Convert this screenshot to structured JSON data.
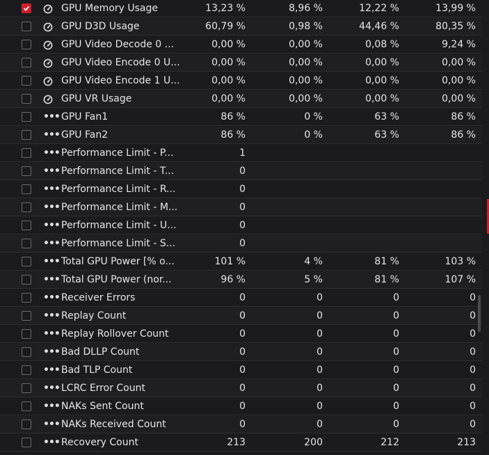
{
  "icons": {
    "gauge": "gauge-icon",
    "more": "more-icon",
    "check": "checkmark-icon"
  },
  "colors": {
    "accent": "#d01f2a",
    "background": "#1b1b1d",
    "row_alt": "#1f1f21",
    "divider": "#2e2e31"
  },
  "rows": [
    {
      "name": "GPU Memory Usage",
      "icon": "gauge",
      "checked": true,
      "v1": "13,23 %",
      "v2": "8,96 %",
      "v3": "12,22 %",
      "v4": "13,99 %"
    },
    {
      "name": "GPU D3D Usage",
      "icon": "gauge",
      "checked": false,
      "v1": "60,79 %",
      "v2": "0,98 %",
      "v3": "44,46 %",
      "v4": "80,35 %"
    },
    {
      "name": "GPU Video Decode 0 ...",
      "icon": "gauge",
      "checked": false,
      "v1": "0,00 %",
      "v2": "0,00 %",
      "v3": "0,08 %",
      "v4": "9,24 %"
    },
    {
      "name": "GPU Video Encode 0 U...",
      "icon": "gauge",
      "checked": false,
      "v1": "0,00 %",
      "v2": "0,00 %",
      "v3": "0,00 %",
      "v4": "0,00 %"
    },
    {
      "name": "GPU Video Encode 1 U...",
      "icon": "gauge",
      "checked": false,
      "v1": "0,00 %",
      "v2": "0,00 %",
      "v3": "0,00 %",
      "v4": "0,00 %"
    },
    {
      "name": "GPU VR Usage",
      "icon": "gauge",
      "checked": false,
      "v1": "0,00 %",
      "v2": "0,00 %",
      "v3": "0,00 %",
      "v4": "0,00 %"
    },
    {
      "name": "GPU Fan1",
      "icon": "more",
      "checked": false,
      "v1": "86 %",
      "v2": "0 %",
      "v3": "63 %",
      "v4": "86 %"
    },
    {
      "name": "GPU Fan2",
      "icon": "more",
      "checked": false,
      "v1": "86 %",
      "v2": "0 %",
      "v3": "63 %",
      "v4": "86 %"
    },
    {
      "name": "Performance Limit - P...",
      "icon": "more",
      "checked": false,
      "v1": "1",
      "v2": "",
      "v3": "",
      "v4": ""
    },
    {
      "name": "Performance Limit - T...",
      "icon": "more",
      "checked": false,
      "v1": "0",
      "v2": "",
      "v3": "",
      "v4": ""
    },
    {
      "name": "Performance Limit - R...",
      "icon": "more",
      "checked": false,
      "v1": "0",
      "v2": "",
      "v3": "",
      "v4": ""
    },
    {
      "name": "Performance Limit - M...",
      "icon": "more",
      "checked": false,
      "v1": "0",
      "v2": "",
      "v3": "",
      "v4": ""
    },
    {
      "name": "Performance Limit - U...",
      "icon": "more",
      "checked": false,
      "v1": "0",
      "v2": "",
      "v3": "",
      "v4": ""
    },
    {
      "name": "Performance Limit - S...",
      "icon": "more",
      "checked": false,
      "v1": "0",
      "v2": "",
      "v3": "",
      "v4": ""
    },
    {
      "name": "Total GPU Power [% o...",
      "icon": "more",
      "checked": false,
      "v1": "101 %",
      "v2": "4 %",
      "v3": "81 %",
      "v4": "103 %"
    },
    {
      "name": "Total GPU Power (nor...",
      "icon": "more",
      "checked": false,
      "v1": "96 %",
      "v2": "5 %",
      "v3": "81 %",
      "v4": "107 %"
    },
    {
      "name": "Receiver Errors",
      "icon": "more",
      "checked": false,
      "v1": "0",
      "v2": "0",
      "v3": "0",
      "v4": "0"
    },
    {
      "name": "Replay Count",
      "icon": "more",
      "checked": false,
      "v1": "0",
      "v2": "0",
      "v3": "0",
      "v4": "0"
    },
    {
      "name": "Replay Rollover Count",
      "icon": "more",
      "checked": false,
      "v1": "0",
      "v2": "0",
      "v3": "0",
      "v4": "0"
    },
    {
      "name": "Bad DLLP Count",
      "icon": "more",
      "checked": false,
      "v1": "0",
      "v2": "0",
      "v3": "0",
      "v4": "0"
    },
    {
      "name": "Bad TLP Count",
      "icon": "more",
      "checked": false,
      "v1": "0",
      "v2": "0",
      "v3": "0",
      "v4": "0"
    },
    {
      "name": "LCRC Error Count",
      "icon": "more",
      "checked": false,
      "v1": "0",
      "v2": "0",
      "v3": "0",
      "v4": "0"
    },
    {
      "name": "NAKs Sent Count",
      "icon": "more",
      "checked": false,
      "v1": "0",
      "v2": "0",
      "v3": "0",
      "v4": "0"
    },
    {
      "name": "NAKs Received Count",
      "icon": "more",
      "checked": false,
      "v1": "0",
      "v2": "0",
      "v3": "0",
      "v4": "0"
    },
    {
      "name": "Recovery Count",
      "icon": "more",
      "checked": false,
      "v1": "213",
      "v2": "200",
      "v3": "212",
      "v4": "213"
    }
  ]
}
